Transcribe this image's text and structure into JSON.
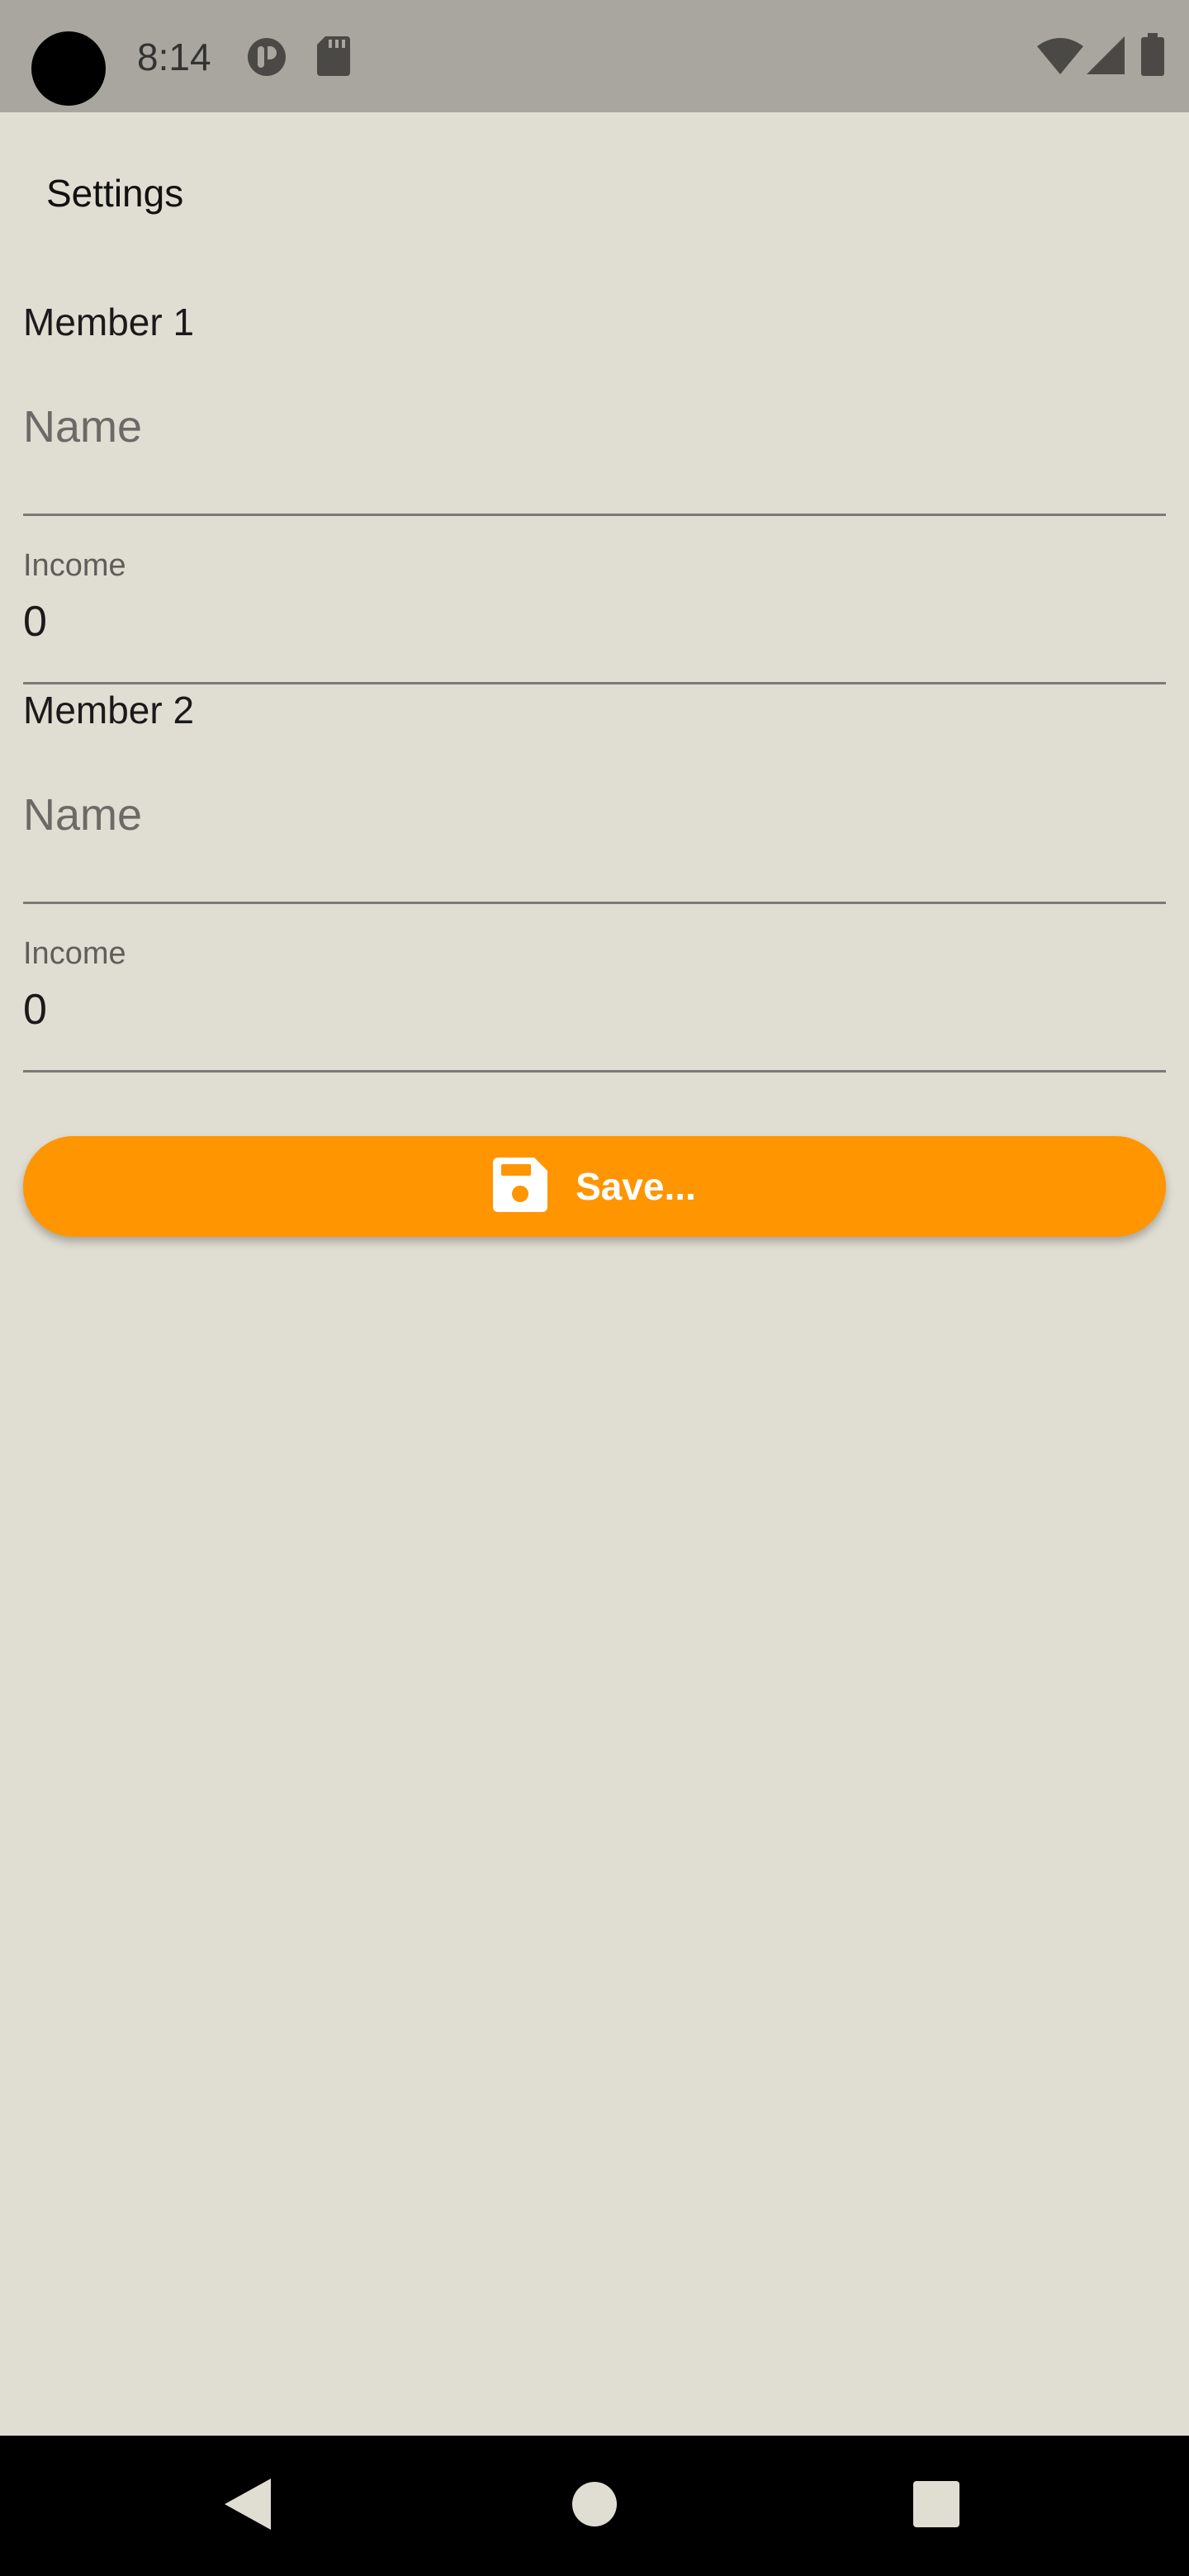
{
  "status_bar": {
    "time": "8:14",
    "icons": [
      "camera-cutout",
      "app-notification-icon",
      "sd-card-icon",
      "wifi-icon",
      "signal-icon",
      "battery-icon"
    ]
  },
  "app_bar": {
    "title": "Settings"
  },
  "members": [
    {
      "heading": "Member 1",
      "name_field": {
        "placeholder": "Name",
        "value": ""
      },
      "income_field": {
        "label": "Income",
        "value": "0"
      }
    },
    {
      "heading": "Member 2",
      "name_field": {
        "placeholder": "Name",
        "value": ""
      },
      "income_field": {
        "label": "Income",
        "value": "0"
      }
    }
  ],
  "actions": {
    "save_label": "Save...",
    "save_icon": "floppy-disk-icon"
  },
  "nav_bar": {
    "buttons": [
      "back-icon",
      "home-icon",
      "recents-icon"
    ]
  },
  "colors": {
    "background": "#e0ddd2",
    "status_bar": "#a8a69f",
    "accent": "#ff9500",
    "nav_bar": "#000000"
  }
}
